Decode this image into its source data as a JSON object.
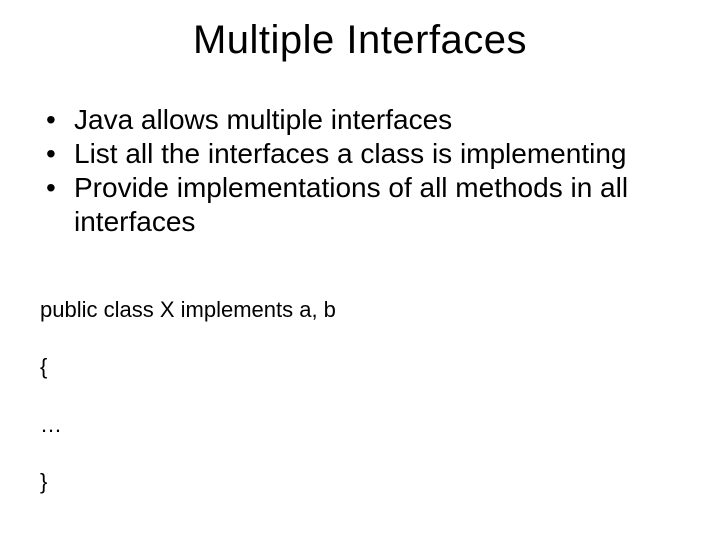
{
  "title": "Multiple Interfaces",
  "bullets": [
    "Java allows multiple interfaces",
    "List all the interfaces a class is implementing",
    "Provide implementations of all methods in all interfaces"
  ],
  "code": {
    "line1": "public class X implements a, b",
    "line2": "{",
    "line3": "…",
    "line4": "}"
  }
}
